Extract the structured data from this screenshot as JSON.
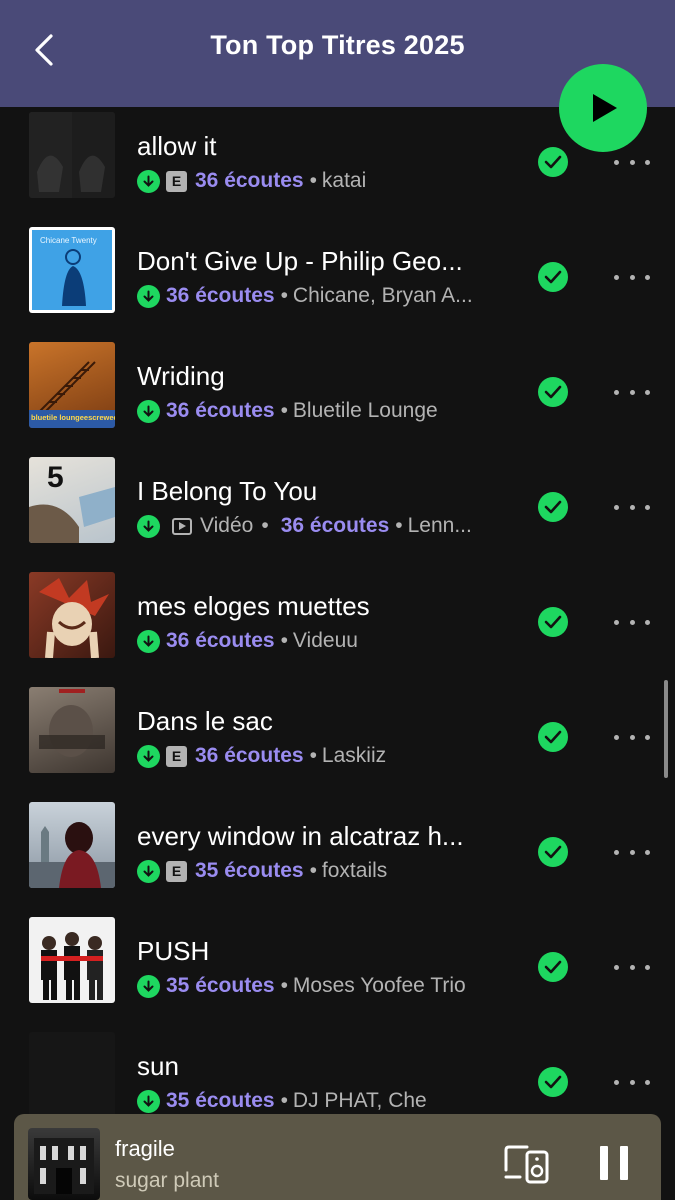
{
  "header": {
    "title": "Ton Top Titres 2025",
    "back_icon": "chevron-left-icon",
    "play_icon": "play-icon",
    "accent": "#1ed760",
    "bg": "#4a4a78"
  },
  "tracks": [
    {
      "title": "allow it",
      "explicit": true,
      "plays": "36 écoutes",
      "artist": "katai",
      "video": false
    },
    {
      "title": "Don't Give Up - Philip Geo...",
      "explicit": false,
      "plays": "36 écoutes",
      "artist": "Chicane, Bryan A...",
      "video": false,
      "cover_text": "Chicane  Twenty"
    },
    {
      "title": "Wriding",
      "explicit": false,
      "plays": "36 écoutes",
      "artist": "Bluetile Lounge",
      "video": false,
      "cover_text": "bluetile loungeescrewed"
    },
    {
      "title": "I Belong To You",
      "explicit": false,
      "plays": "36 écoutes",
      "artist": "Lenn...",
      "video": true,
      "video_label": "Vidéo",
      "cover_text": "5"
    },
    {
      "title": "mes eloges muettes",
      "explicit": false,
      "plays": "36 écoutes",
      "artist": "Videuu",
      "video": false
    },
    {
      "title": "Dans le sac",
      "explicit": true,
      "plays": "36 écoutes",
      "artist": "Laskiiz",
      "video": false
    },
    {
      "title": "every window in alcatraz h...",
      "explicit": true,
      "plays": "35 écoutes",
      "artist": "foxtails",
      "video": false
    },
    {
      "title": "PUSH",
      "explicit": false,
      "plays": "35 écoutes",
      "artist": "Moses Yoofee Trio",
      "video": false
    },
    {
      "title": "sun",
      "explicit": false,
      "plays": "35 écoutes",
      "artist": "DJ PHAT, Che",
      "video": false
    }
  ],
  "labels": {
    "explicit_badge": "E",
    "separator": "•"
  },
  "now_playing": {
    "title": "fragile",
    "artist": "sugar plant",
    "device_icon": "connect-device-icon",
    "pause_icon": "pause-icon"
  },
  "colors": {
    "plays_accent": "#9a8cf0",
    "green": "#1ed760",
    "mini_player_bg": "#5c5747"
  }
}
